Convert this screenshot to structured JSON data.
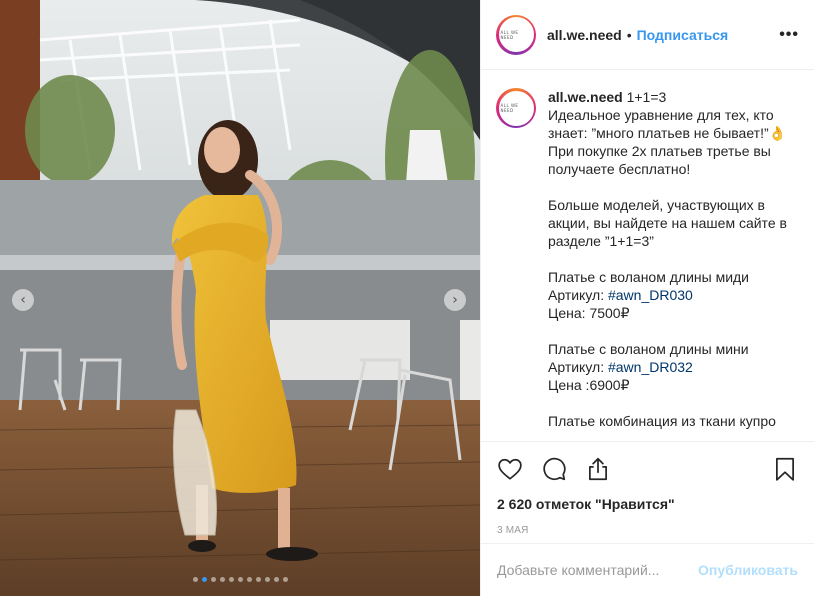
{
  "post": {
    "username": "all.we.need",
    "avatar_text": "ALL WE NEED",
    "separator": "•",
    "follow_label": "Подписаться",
    "more_icon": "more-horizontal-icon",
    "carousel": {
      "total": 11,
      "active_index": 1
    }
  },
  "caption": {
    "username": "all.we.need",
    "title": "1+1=3",
    "line1": "Идеальное уравнение для тех, кто знает: ”много платьев не бывает!”👌",
    "line2": "При покупке 2х платьев третье вы получаете бесплатно!",
    "line3": "Больше моделей, участвующих в акции, вы найдете на нашем сайте в разделе ”1+1=3”",
    "item1_title": "Платье с воланом длины миди",
    "item1_article_label": "Артикул: ",
    "item1_tag": "#awn_DR030",
    "item1_price": "Цена: 7500₽",
    "item2_title": "Платье с воланом длины мини",
    "item2_article_label": "Артикул: ",
    "item2_tag": "#awn_DR032",
    "item2_price": "Цена :6900₽",
    "item3_title": "Платье комбинация из ткани купро"
  },
  "actions": {
    "like_icon": "heart-icon",
    "comment_icon": "comment-icon",
    "share_icon": "share-icon",
    "save_icon": "bookmark-icon",
    "likes_text": "2 620 отметок \"Нравится\"",
    "date": "3 МАЯ"
  },
  "comment": {
    "placeholder": "Добавьте комментарий...",
    "publish_label": "Опубликовать"
  },
  "colors": {
    "link_blue": "#3897f0",
    "hashtag": "#003569",
    "dress_yellow": "#e6b42a"
  }
}
